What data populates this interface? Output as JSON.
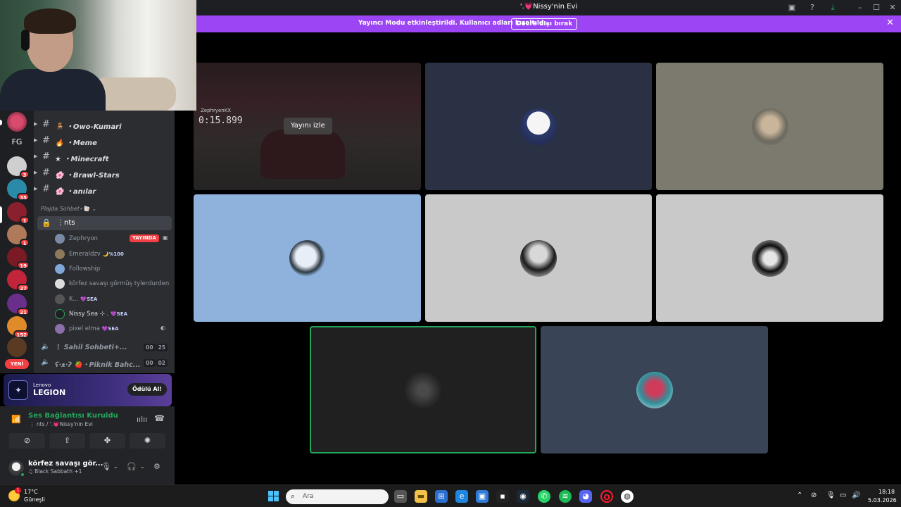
{
  "window": {
    "title": "'.💗Nissy'nin Evi",
    "buttons": [
      "inbox-icon",
      "help-icon",
      "download-icon",
      "minimize-icon",
      "maximize-icon",
      "close-icon"
    ]
  },
  "banner": {
    "message": "Yayıncı Modu etkinleştirildi. Kullanıcı adları kısaltıldı.",
    "button_label": "Devre dışı bırak"
  },
  "servers": {
    "items": [
      {
        "badge": ""
      },
      {
        "text": "FG",
        "badge": ""
      },
      {
        "badge": "3"
      },
      {
        "badge": "35"
      },
      {
        "badge": "1"
      },
      {
        "badge": "1"
      },
      {
        "badge": "19"
      },
      {
        "badge": "27"
      },
      {
        "badge": "21"
      },
      {
        "badge": "152"
      },
      {
        "badge": ""
      }
    ],
    "new_badge": "YENİ"
  },
  "channels": {
    "text": [
      {
        "emoji": "🪑",
        "label": "・Owo-Kumari"
      },
      {
        "emoji": "🔥",
        "label": "・Meme"
      },
      {
        "emoji": "★",
        "label": "・Minecraft"
      },
      {
        "emoji": "🌸",
        "label": "・Brawl-Stars"
      },
      {
        "emoji": "🌸",
        "label": "・anılar"
      }
    ],
    "category": "Plajda Sohbet⋆🐚",
    "voice_channel": "⋮nts",
    "members": [
      {
        "name": "Zephryon",
        "tag": "",
        "badge": "YAYINDA",
        "avatar_color": "#7a8aa6"
      },
      {
        "name": "Emeraldzv",
        "tag": "🌙%100",
        "badge": "",
        "avatar_color": "#8c7a5a"
      },
      {
        "name": "Followship",
        "tag": "",
        "badge": "",
        "avatar_color": "#7fa7d8"
      },
      {
        "name": "körfez savaşı görmüş tylerdurden",
        "tag": "",
        "badge": "",
        "avatar_color": "#dcdcdc"
      },
      {
        "name": "K...",
        "tag": "💜SEA",
        "badge": "",
        "avatar_color": "#555"
      },
      {
        "name": "Nissy Sea ⊹ .",
        "tag": "💜SEA",
        "badge": "",
        "avatar_color": "#2b6d46"
      },
      {
        "name": "pixel elma",
        "tag": "💜SEA",
        "badge": "",
        "avatar_color": "#8a6fa8"
      }
    ],
    "other_voice": [
      {
        "label": "⋮ Sahil Sohbeti+...",
        "count_a": "00",
        "count_b": "25"
      },
      {
        "label": "ʕ·ᴥ·ʔ 🍓・Piknik Bahc...",
        "count_a": "00",
        "count_b": "02"
      }
    ]
  },
  "ad": {
    "brand_top": "Lenovo",
    "brand_main": "LEGION",
    "button_label": "Ödülü Al!"
  },
  "voice_panel": {
    "status": "Ses Bağlantısı Kuruldu",
    "sub": "⋮ nts / '.💗Nissy'nin Evi"
  },
  "user_panel": {
    "name": "körfez savaşı gör...",
    "activity": "♫ Black Sabbath +1"
  },
  "stage": {
    "stream": {
      "watch_label": "Yayını izle",
      "timer": "0:15.899",
      "player": "ZephryonKX"
    },
    "tiles": [
      {
        "bg": "#2b3145"
      },
      {
        "bg": "#7c7a6f"
      },
      {
        "bg": "#8eb2db"
      },
      {
        "bg": "#c9c9c9"
      },
      {
        "bg": "#c9c9c9"
      },
      {
        "bg": "#202020",
        "speaking": true
      },
      {
        "bg": "#3a4457"
      }
    ]
  },
  "taskbar": {
    "temp": "17°C",
    "condition": "Güneşli",
    "weather_badge": "1",
    "search_placeholder": "Ara",
    "time": "18:18",
    "date": "5.03.2026"
  },
  "colors": {
    "banner": "#9b45f4",
    "live": "#f23f43",
    "connected": "#23a55a",
    "speaking_ring": "#23a55a"
  }
}
